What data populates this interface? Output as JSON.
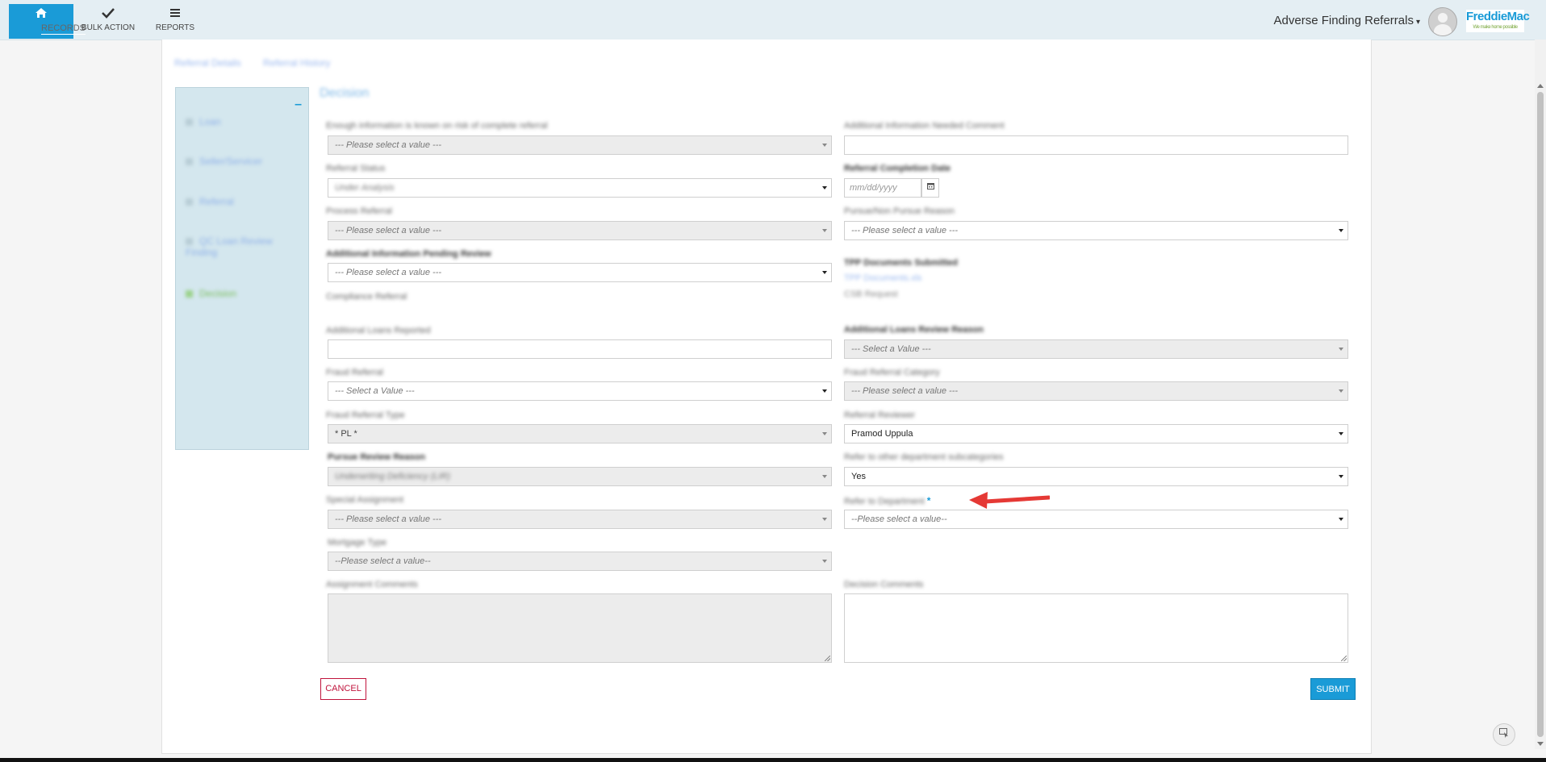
{
  "nav": {
    "records": "RECORDS",
    "bulk_action": "BULK ACTION",
    "reports": "REPORTS"
  },
  "header": {
    "app_title": "Adverse Finding Referrals",
    "logo_text": "FreddieMac",
    "logo_tagline": "We make home possible"
  },
  "breadcrumb": [
    "Referral Details",
    "Referral History"
  ],
  "sidebar": {
    "collapse_symbol": "–",
    "items": [
      {
        "label": "Loan"
      },
      {
        "label": "Seller/Servicer"
      },
      {
        "label": "Referral"
      },
      {
        "label": "QC Loan Review Finding"
      },
      {
        "label": "Decision"
      }
    ]
  },
  "section_title": "Decision",
  "form": {
    "left": {
      "f1_label": "Enough information is known on risk of complete referral",
      "f1_value": "--- Please select a value ---",
      "f2_label": "Referral Status",
      "f2_value": "Under Analysis",
      "f3_label": "Process Referral",
      "f3_value": "--- Please select a value ---",
      "f4_label": "Additional Information Pending Review",
      "f4_value": "--- Please select a value ---",
      "f5_label": "Compliance Referral",
      "f6_label": "Additional Loans Reported",
      "f6_value": "",
      "f7_label": "Fraud Referral",
      "f7_value": "--- Select a Value ---",
      "f8_label": "Fraud Referral Type",
      "f8_value": "* PL *",
      "f9_label": "Pursue Review Reason",
      "f9_value": "Underwriting Deficiency (LIR)",
      "f10_label": "Special Assignment",
      "f10_value": "--- Please select a value ---",
      "f11_label": "Mortgage Type",
      "f11_value": "--Please select a value--",
      "f12_label": "Assignment Comments"
    },
    "right": {
      "r1_label": "Additional Information Needed Comment",
      "r1_value": "",
      "r2_label": "Referral Completion Date",
      "r2_placeholder": "mm/dd/yyyy",
      "r3_label": "Pursue/Non Pursue Reason",
      "r3_value": "--- Please select a value ---",
      "r4_label": "TPP Documents Submitted",
      "r4_link": "TPP Documents.xls",
      "r4_sub": "CSB Request",
      "r5_label": "Additional Loans Review Reason",
      "r5_value": "--- Select a Value ---",
      "r6_label": "Fraud Referral Category",
      "r6_value": "--- Please select a value ---",
      "r7_label": "Referral Reviewer",
      "r7_value": "Pramod Uppula",
      "r8_label": "Refer to other department subcategories",
      "r8_value": "Yes",
      "r9_label": "Refer to Department",
      "r9_value": "--Please select a value--",
      "r9_required": "*",
      "r10_label": "Decision Comments"
    }
  },
  "buttons": {
    "cancel": "CANCEL",
    "submit": "SUBMIT"
  },
  "colors": {
    "brand_blue": "#1a9bd7",
    "cancel_red": "#c0143c",
    "annotation_arrow": "#e53935"
  }
}
